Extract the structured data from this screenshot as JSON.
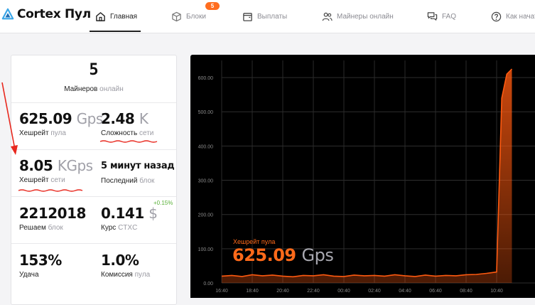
{
  "app": {
    "name": "Cortex Пул"
  },
  "nav": [
    {
      "label": "Главная",
      "icon": "home-icon",
      "active": true
    },
    {
      "label": "Блоки",
      "icon": "cube-icon",
      "badge": "5"
    },
    {
      "label": "Выплаты",
      "icon": "wallet-icon"
    },
    {
      "label": "Майнеры онлайн",
      "icon": "users-icon"
    },
    {
      "label": "FAQ",
      "icon": "chat-icon"
    },
    {
      "label": "Как начать",
      "icon": "help-icon"
    }
  ],
  "stats": {
    "miners": {
      "value": "5",
      "label": "Майнеров",
      "label_muted": "онлайн"
    },
    "pool_hashrate": {
      "value": "625.09",
      "unit": "Gps",
      "label": "Хешрейт",
      "label_muted": "пула"
    },
    "difficulty": {
      "value": "2.48",
      "unit": "K",
      "label": "Сложность",
      "label_muted": "сети"
    },
    "network_hashrate": {
      "value": "8.05",
      "unit": "KGps",
      "label": "Хешрейт",
      "label_muted": "сети"
    },
    "last_block": {
      "value": "5 минут назад",
      "label": "Последний",
      "label_muted": "блок"
    },
    "solved": {
      "value": "2212018",
      "label": "Решаем",
      "label_muted": "блок"
    },
    "price": {
      "value": "0.141",
      "unit": "$",
      "change": "+0.15%",
      "label": "Курс",
      "label_muted": "CTXC"
    },
    "luck": {
      "value": "153%",
      "label": "Удача"
    },
    "fee": {
      "value": "1.0%",
      "label": "Комиссия",
      "label_muted": "пула"
    }
  },
  "chart_overlay": {
    "label": "Хешрейт пула",
    "value": "625.09",
    "unit": "Gps"
  },
  "colors": {
    "accent": "#ff6d1f",
    "line": "#ff5a10",
    "annotation": "#e8281e",
    "positive": "#58b038"
  },
  "chart_data": {
    "type": "area",
    "title": "",
    "xlabel": "",
    "ylabel": "",
    "ylim": [
      0,
      650
    ],
    "yticks": [
      "0.00",
      "100.00",
      "200.00",
      "300.00",
      "400.00",
      "500.00",
      "600.00"
    ],
    "xticks": [
      "16:40",
      "18:40",
      "20:40",
      "22:40",
      "00:40",
      "02:40",
      "04:40",
      "06:40",
      "08:40",
      "10:40"
    ],
    "series": [
      {
        "x": [
          "16:40",
          "17:20",
          "18:00",
          "18:40",
          "19:20",
          "20:00",
          "20:40",
          "21:20",
          "22:00",
          "22:40",
          "23:20",
          "00:00",
          "00:40",
          "01:20",
          "02:00",
          "02:40",
          "03:20",
          "04:00",
          "04:40",
          "05:20",
          "06:00",
          "06:40",
          "07:20",
          "08:00",
          "08:40",
          "09:20",
          "10:00",
          "10:20",
          "10:40",
          "11:00",
          "11:20",
          "11:40"
        ],
        "values": [
          20,
          22,
          19,
          24,
          21,
          23,
          20,
          18,
          22,
          21,
          24,
          20,
          19,
          23,
          21,
          22,
          20,
          24,
          21,
          19,
          23,
          20,
          22,
          21,
          24,
          25,
          28,
          30,
          32,
          540,
          610,
          625
        ]
      }
    ]
  }
}
